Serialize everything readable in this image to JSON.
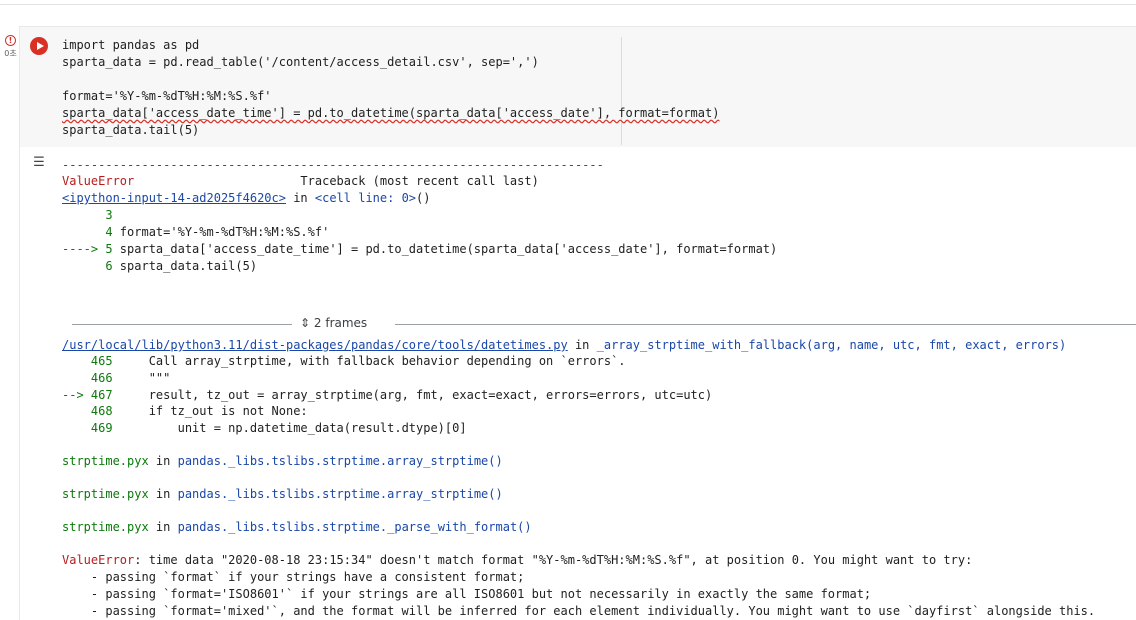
{
  "status": {
    "error_icon": "!",
    "exec_time": "0초"
  },
  "code_lines": [
    "import pandas as pd",
    "sparta_data = pd.read_table('/content/access_detail.csv', sep=',')",
    "",
    "format='%Y-%m-%dT%H:%M:%S.%f'",
    "sparta_data['access_date_time'] = pd.to_datetime(sparta_data['access_date'], format=format)",
    "sparta_data.tail(5)"
  ],
  "output": {
    "dashes": "---------------------------------------------------------------------------",
    "error_name": "ValueError",
    "traceback_title": "Traceback (most recent call last)",
    "input_link": "<ipython-input-14-ad2025f4620c>",
    "in_text": " in ",
    "cell_line": "<cell line: 0>",
    "cell_paren": "()",
    "ctx1": [
      {
        "num": "      3",
        "text": ""
      },
      {
        "num": "      4",
        "text": " format='%Y-%m-%dT%H:%M:%S.%f'"
      },
      {
        "num": "----> 5",
        "text": " sparta_data['access_date_time'] = pd.to_datetime(sparta_data['access_date'], format=format)"
      },
      {
        "num": "      6",
        "text": " sparta_data.tail(5)"
      }
    ],
    "frames_label": "2 frames",
    "path_link": "/usr/local/lib/python3.11/dist-packages/pandas/core/tools/datetimes.py",
    "func_sig": "_array_strptime_with_fallback(arg, name, utc, fmt, exact, errors)",
    "ctx2": [
      {
        "num": "    465",
        "text": "     Call array_strptime, with fallback behavior depending on `errors`."
      },
      {
        "num": "    466",
        "text": "     \"\"\""
      },
      {
        "num": "--> 467",
        "text": "     result, tz_out = array_strptime(arg, fmt, exact=exact, errors=errors, utc=utc)"
      },
      {
        "num": "    468",
        "text": "     if tz_out is not None:"
      },
      {
        "num": "    469",
        "text": "         unit = np.datetime_data(result.dtype)[0]"
      }
    ],
    "pyx_frames": [
      {
        "file": "strptime.pyx",
        "func": "pandas._libs.tslibs.strptime.array_strptime()"
      },
      {
        "file": "strptime.pyx",
        "func": "pandas._libs.tslibs.strptime.array_strptime()"
      },
      {
        "file": "strptime.pyx",
        "func": "pandas._libs.tslibs.strptime._parse_with_format()"
      }
    ],
    "final_error_msg": ": time data \"2020-08-18 23:15:34\" doesn't match format \"%Y-%m-%dT%H:%M:%S.%f\", at position 0. You might want to try:",
    "suggestions": [
      "    - passing `format` if your strings have a consistent format;",
      "    - passing `format='ISO8601'` if your strings are all ISO8601 but not necessarily in exactly the same format;",
      "    - passing `format='mixed'`, and the format will be inferred for each element individually. You might want to use `dayfirst` alongside this."
    ]
  }
}
